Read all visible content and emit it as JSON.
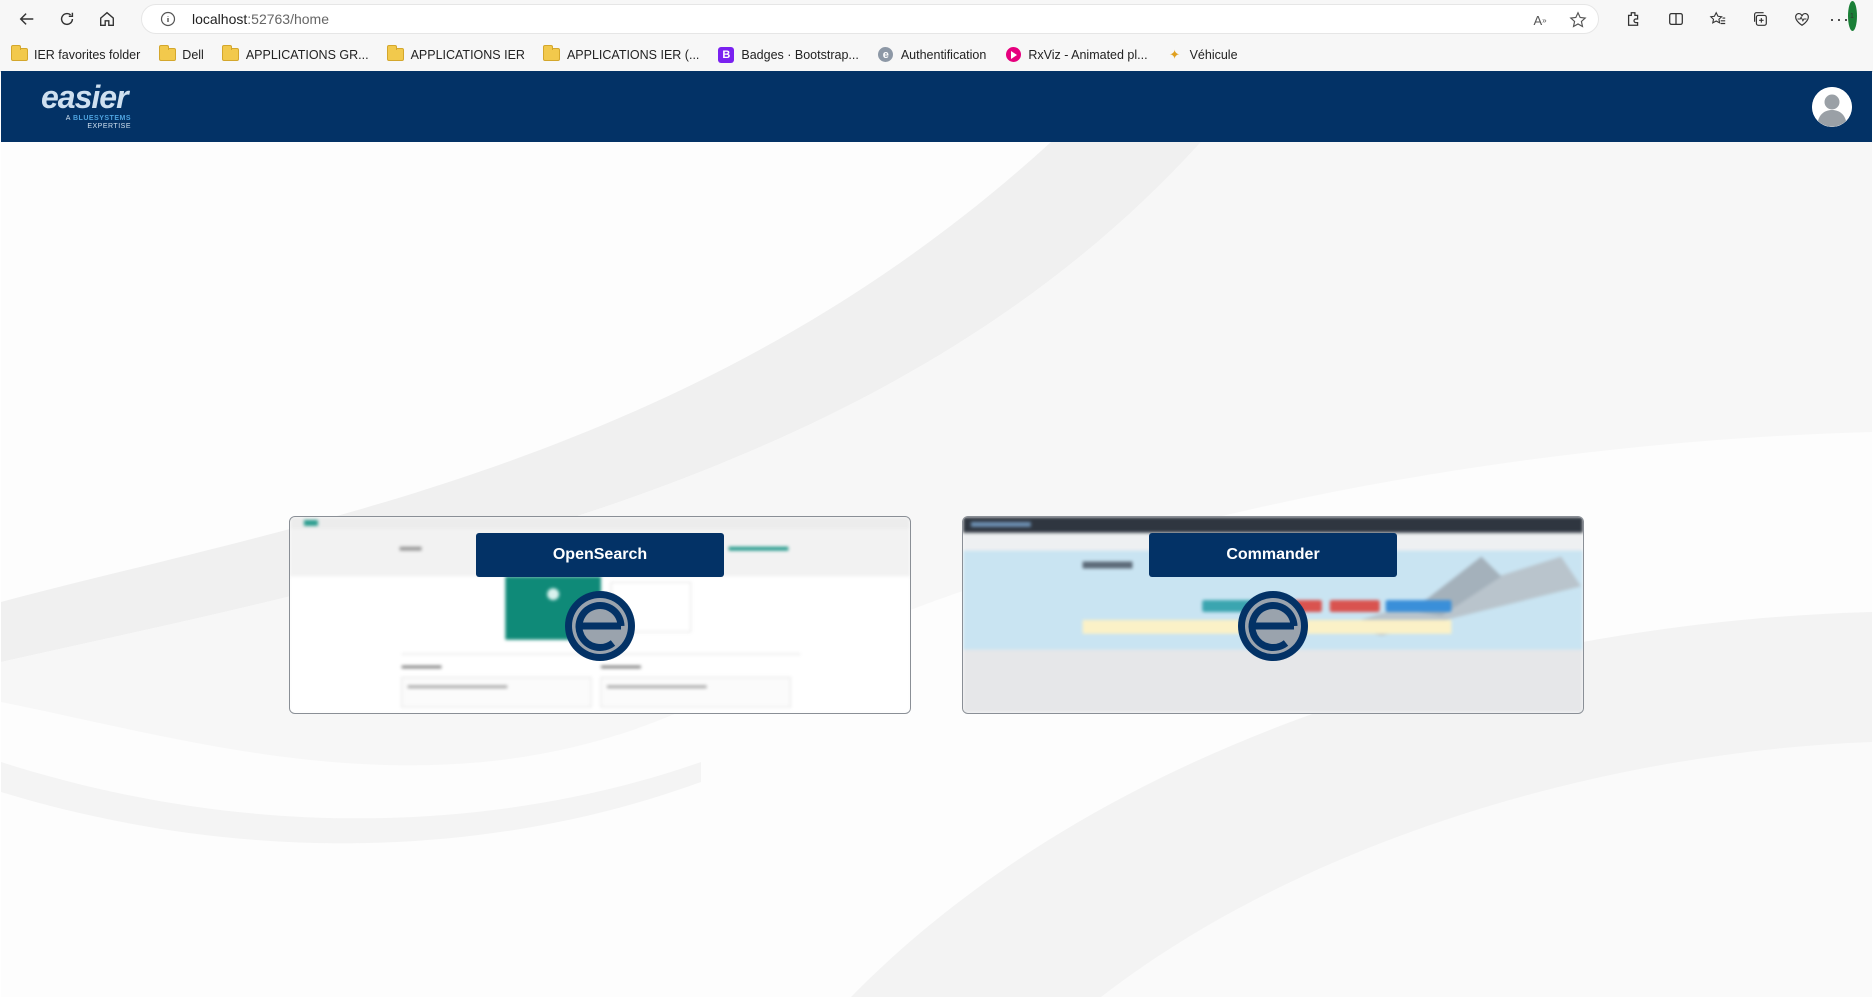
{
  "browser": {
    "url_host": "localhost",
    "url_path": ":52763/home",
    "bookmarks": [
      {
        "label": "IER favorites folder",
        "icon": "folder-icon"
      },
      {
        "label": "Dell",
        "icon": "folder-icon"
      },
      {
        "label": "APPLICATIONS GR...",
        "icon": "folder-icon"
      },
      {
        "label": "APPLICATIONS IER",
        "icon": "folder-icon"
      },
      {
        "label": "APPLICATIONS IER (...",
        "icon": "folder-icon"
      },
      {
        "label": "Badges · Bootstrap...",
        "icon": "bootstrap-icon"
      },
      {
        "label": "Authentification",
        "icon": "easier-icon"
      },
      {
        "label": "RxViz - Animated pl...",
        "icon": "rxviz-icon"
      },
      {
        "label": "Véhicule",
        "icon": "vehicle-icon"
      }
    ],
    "badge_count": "1"
  },
  "app": {
    "logo_word": "easier",
    "logo_tagline_1": "A",
    "logo_tagline_brand": "BLUESYSTEMS",
    "logo_tagline_2": "EXPERTISE",
    "brand_color": "#033266"
  },
  "cards": [
    {
      "title": "OpenSearch"
    },
    {
      "title": "Commander"
    }
  ]
}
